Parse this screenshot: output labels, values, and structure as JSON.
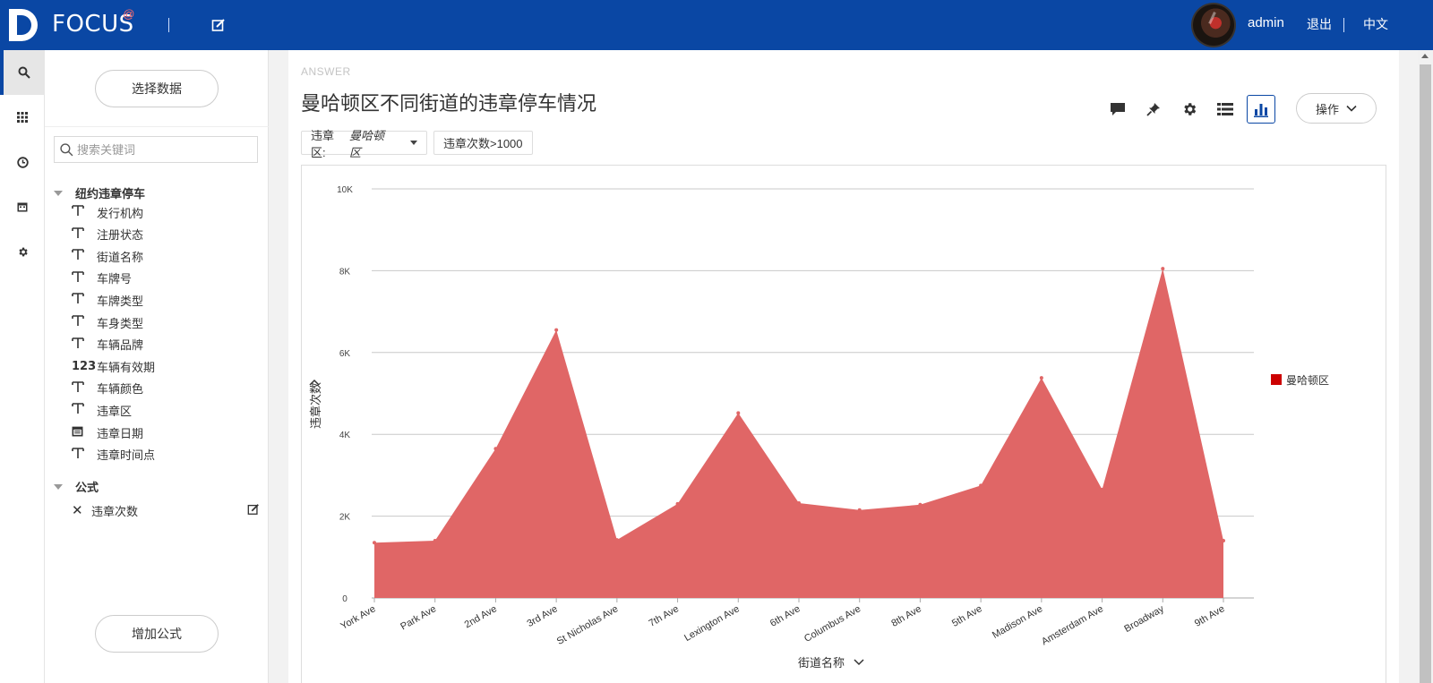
{
  "header": {
    "logo_text": "FOCUS",
    "logo_sup": "@",
    "username": "admin",
    "logout_label": "退出",
    "lang_label": "中文"
  },
  "rail": {
    "items": [
      "search-icon",
      "apps-grid-icon",
      "history-clock-icon",
      "calendar-icon",
      "settings-gear-icon"
    ]
  },
  "panel": {
    "select_data_label": "选择数据",
    "search_placeholder": "搜索关键词",
    "group_title": "纽约违章停车",
    "fields": [
      {
        "type": "T",
        "label": "发行机构"
      },
      {
        "type": "T",
        "label": "注册状态"
      },
      {
        "type": "T",
        "label": "街道名称"
      },
      {
        "type": "T",
        "label": "车牌号"
      },
      {
        "type": "T",
        "label": "车牌类型"
      },
      {
        "type": "T",
        "label": "车身类型"
      },
      {
        "type": "T",
        "label": "车辆品牌"
      },
      {
        "type": "123",
        "label": "车辆有效期"
      },
      {
        "type": "T",
        "label": "车辆颜色"
      },
      {
        "type": "T",
        "label": "违章区"
      },
      {
        "type": "date",
        "label": "违章日期"
      },
      {
        "type": "T",
        "label": "违章时间点"
      }
    ],
    "formula_group_title": "公式",
    "formula_item": "违章次数",
    "add_formula_label": "增加公式"
  },
  "main": {
    "answer_label": "ANSWER",
    "title": "曼哈顿区不同街道的违章停车情况",
    "ops_label": "操作",
    "filter1_prefix": "违章区: ",
    "filter1_value": "曼哈顿区",
    "filter2": "违章次数>1000"
  },
  "colors": {
    "brand": "#0a47a4",
    "series": "#e06666",
    "legend_swatch": "#cc0000"
  },
  "chart_data": {
    "type": "area",
    "categories": [
      "York Ave",
      "Park Ave",
      "2nd Ave",
      "3rd Ave",
      "St Nicholas Ave",
      "7th Ave",
      "Lexington Ave",
      "6th Ave",
      "Columbus Ave",
      "8th Ave",
      "5th Ave",
      "Madison Ave",
      "Amsterdam Ave",
      "Broadway",
      "9th Ave"
    ],
    "series": [
      {
        "name": "曼哈顿区",
        "values": [
          1350,
          1400,
          3650,
          6550,
          1420,
          2300,
          4520,
          2320,
          2150,
          2280,
          2750,
          5380,
          2650,
          8050,
          1400
        ]
      }
    ],
    "ylim": [
      0,
      10000
    ],
    "yticks": [
      0,
      2000,
      4000,
      6000,
      8000,
      10000
    ],
    "ytick_labels": [
      "0",
      "2K",
      "4K",
      "6K",
      "8K",
      "10K"
    ],
    "xlabel": "街道名称",
    "ylabel": "违章次数",
    "grid": true,
    "legend_position": "right"
  }
}
